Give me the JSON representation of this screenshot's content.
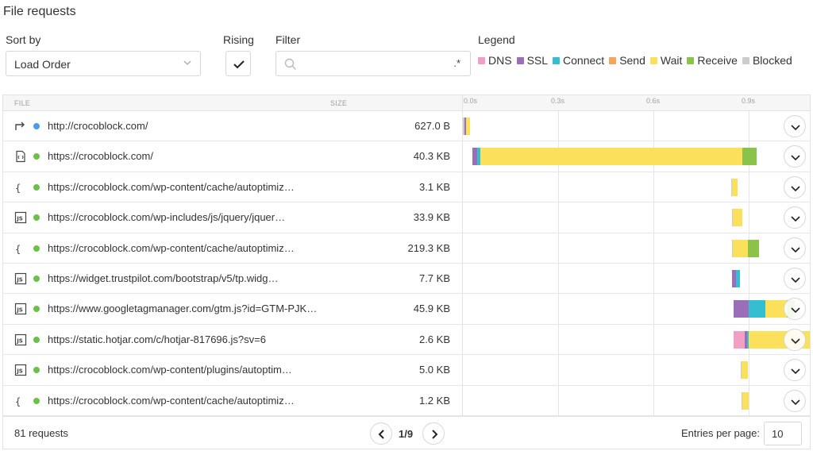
{
  "title": "File requests",
  "controls": {
    "sort_label": "Sort by",
    "sort_value": "Load Order",
    "rising_label": "Rising",
    "rising_checked": true,
    "filter_label": "Filter",
    "filter_value": "",
    "filter_regex_label": ".*",
    "legend_label": "Legend"
  },
  "legend": [
    {
      "name": "DNS",
      "color": "#f29fc5"
    },
    {
      "name": "SSL",
      "color": "#9b6fb8"
    },
    {
      "name": "Connect",
      "color": "#35bdd1"
    },
    {
      "name": "Send",
      "color": "#f4a55a"
    },
    {
      "name": "Wait",
      "color": "#fbe15b"
    },
    {
      "name": "Receive",
      "color": "#8bc34a"
    },
    {
      "name": "Blocked",
      "color": "#cccccc"
    }
  ],
  "table": {
    "col_file": "FILE",
    "col_size": "SIZE",
    "ticks": [
      "0.0s",
      "0.3s",
      "0.6s",
      "0.9s"
    ],
    "rows": [
      {
        "icon": "redirect-icon",
        "status_color": "#4a9de8",
        "url": "http://crocoblock.com/",
        "size": "627.0 B",
        "timings": [
          {
            "type": "Blocked",
            "start": 0.0,
            "dur": 0.005
          },
          {
            "type": "SSL",
            "start": 0.005,
            "dur": 0.005
          },
          {
            "type": "Wait",
            "start": 0.01,
            "dur": 0.012
          }
        ]
      },
      {
        "icon": "html-file-icon",
        "status_color": "#6cc04a",
        "url": "https://crocoblock.com/",
        "size": "40.3 KB",
        "timings": [
          {
            "type": "SSL",
            "start": 0.03,
            "dur": 0.015
          },
          {
            "type": "Connect",
            "start": 0.045,
            "dur": 0.01
          },
          {
            "type": "Wait",
            "start": 0.055,
            "dur": 0.825
          },
          {
            "type": "Receive",
            "start": 0.88,
            "dur": 0.045
          }
        ]
      },
      {
        "icon": "json-file-icon",
        "status_color": "#6cc04a",
        "url": "https://crocoblock.com/wp-content/cache/autoptimiz…",
        "size": "3.1 KB",
        "timings": [
          {
            "type": "Blocked",
            "start": 0.845,
            "dur": 0.003
          },
          {
            "type": "Wait",
            "start": 0.848,
            "dur": 0.017
          }
        ]
      },
      {
        "icon": "js-file-icon",
        "status_color": "#6cc04a",
        "url": "https://crocoblock.com/wp-includes/js/jquery/jquer…",
        "size": "33.9 KB",
        "timings": [
          {
            "type": "Blocked",
            "start": 0.848,
            "dur": 0.003
          },
          {
            "type": "Wait",
            "start": 0.851,
            "dur": 0.029
          }
        ]
      },
      {
        "icon": "json-file-icon",
        "status_color": "#6cc04a",
        "url": "https://crocoblock.com/wp-content/cache/autoptimiz…",
        "size": "219.3 KB",
        "timings": [
          {
            "type": "Blocked",
            "start": 0.848,
            "dur": 0.003
          },
          {
            "type": "Wait",
            "start": 0.851,
            "dur": 0.047
          },
          {
            "type": "Receive",
            "start": 0.898,
            "dur": 0.035
          }
        ]
      },
      {
        "icon": "js-file-icon",
        "status_color": "#6cc04a",
        "url": "https://widget.trustpilot.com/bootstrap/v5/tp.widg…",
        "size": "7.7 KB",
        "timings": [
          {
            "type": "SSL",
            "start": 0.848,
            "dur": 0.012
          },
          {
            "type": "Connect",
            "start": 0.86,
            "dur": 0.013
          }
        ]
      },
      {
        "icon": "js-file-icon",
        "status_color": "#6cc04a",
        "url": "https://www.googletagmanager.com/gtm.js?id=GTM-PJK…",
        "size": "45.9 KB",
        "timings": [
          {
            "type": "SSL",
            "start": 0.852,
            "dur": 0.048
          },
          {
            "type": "Connect",
            "start": 0.9,
            "dur": 0.052
          },
          {
            "type": "Wait",
            "start": 0.952,
            "dur": 0.068
          },
          {
            "type": "Receive",
            "start": 1.02,
            "dur": 0.025
          }
        ]
      },
      {
        "icon": "js-file-icon",
        "status_color": "#6cc04a",
        "url": "https://static.hotjar.com/c/hotjar-817696.js?sv=6",
        "size": "2.6 KB",
        "timings": [
          {
            "type": "DNS",
            "start": 0.852,
            "dur": 0.035
          },
          {
            "type": "SSL",
            "start": 0.887,
            "dur": 0.007
          },
          {
            "type": "Connect",
            "start": 0.894,
            "dur": 0.007
          },
          {
            "type": "Wait",
            "start": 0.901,
            "dur": 0.22
          }
        ]
      },
      {
        "icon": "js-file-icon",
        "status_color": "#6cc04a",
        "url": "https://crocoblock.com/wp-content/plugins/autoptim…",
        "size": "5.0 KB",
        "timings": [
          {
            "type": "Blocked",
            "start": 0.875,
            "dur": 0.003
          },
          {
            "type": "Wait",
            "start": 0.878,
            "dur": 0.02
          }
        ]
      },
      {
        "icon": "json-file-icon",
        "status_color": "#6cc04a",
        "url": "https://crocoblock.com/wp-content/cache/autoptimiz…",
        "size": "1.2 KB",
        "timings": [
          {
            "type": "Blocked",
            "start": 0.878,
            "dur": 0.003
          },
          {
            "type": "Wait",
            "start": 0.881,
            "dur": 0.019
          }
        ]
      }
    ]
  },
  "footer": {
    "requests_text": "81 requests",
    "page_text": "1/9",
    "entries_label": "Entries per page:",
    "entries_value": "10"
  }
}
